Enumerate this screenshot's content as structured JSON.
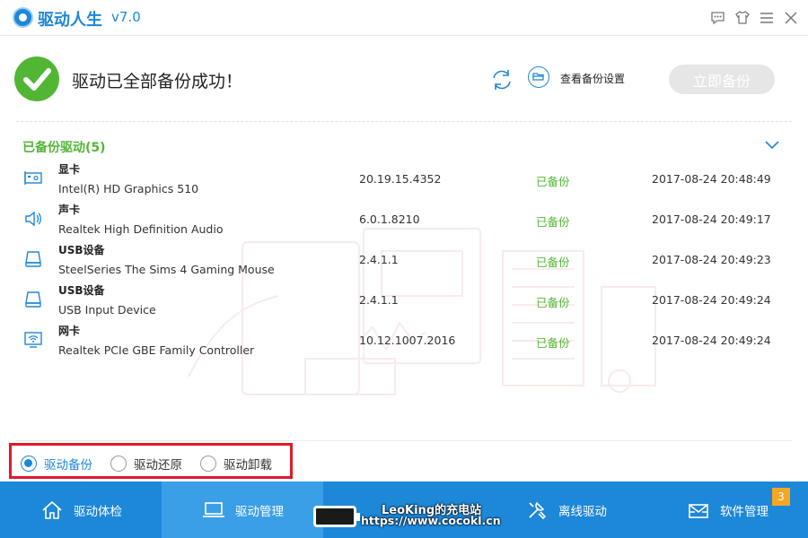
{
  "app": {
    "name": "驱动人生",
    "version": "v7.0"
  },
  "window_controls": [
    "feedback-icon",
    "skin-icon",
    "menu-icon",
    "close-icon"
  ],
  "header": {
    "status_text": "驱动已全部备份成功！",
    "settings_link": "查看备份设置",
    "backup_now_label": "立即备份"
  },
  "section": {
    "title": "已备份驱动(5)"
  },
  "drivers": [
    {
      "icon": "display-card-icon",
      "type": "显卡",
      "name": "Intel(R) HD Graphics 510",
      "version": "20.19.15.4352",
      "status": "已备份",
      "time": "2017-08-24 20:48:49"
    },
    {
      "icon": "speaker-icon",
      "type": "声卡",
      "name": "Realtek High Definition Audio",
      "version": "6.0.1.8210",
      "status": "已备份",
      "time": "2017-08-24 20:49:17"
    },
    {
      "icon": "usb-device-icon",
      "type": "USB设备",
      "name": "SteelSeries The Sims 4 Gaming Mouse",
      "version": "2.4.1.1",
      "status": "已备份",
      "time": "2017-08-24 20:49:23"
    },
    {
      "icon": "usb-device-icon",
      "type": "USB设备",
      "name": "USB Input Device",
      "version": "2.4.1.1",
      "status": "已备份",
      "time": "2017-08-24 20:49:24"
    },
    {
      "icon": "network-card-icon",
      "type": "网卡",
      "name": "Realtek PCIe GBE Family Controller",
      "version": "10.12.1007.2016",
      "status": "已备份",
      "time": "2017-08-24 20:49:24"
    }
  ],
  "modes": [
    {
      "label": "驱动备份",
      "selected": true
    },
    {
      "label": "驱动还原",
      "selected": false
    },
    {
      "label": "驱动卸载",
      "selected": false
    }
  ],
  "nav": [
    {
      "label": "驱动体检",
      "icon": "home-icon",
      "active": false
    },
    {
      "label": "驱动管理",
      "icon": "laptop-icon",
      "active": true
    },
    {
      "label": "",
      "icon": "",
      "active": false
    },
    {
      "label": "离线驱动",
      "icon": "tools-icon",
      "active": false
    },
    {
      "label": "软件管理",
      "icon": "mail-box-icon",
      "active": false
    }
  ],
  "badge_count": "3",
  "watermark": {
    "line1": "LeoKing的充电站",
    "line2": "https://www.cocokl.cn"
  },
  "colors": {
    "primary": "#1d87d8",
    "success": "#52b635",
    "highlight_border": "#e0182c",
    "badge": "#f5a623"
  }
}
